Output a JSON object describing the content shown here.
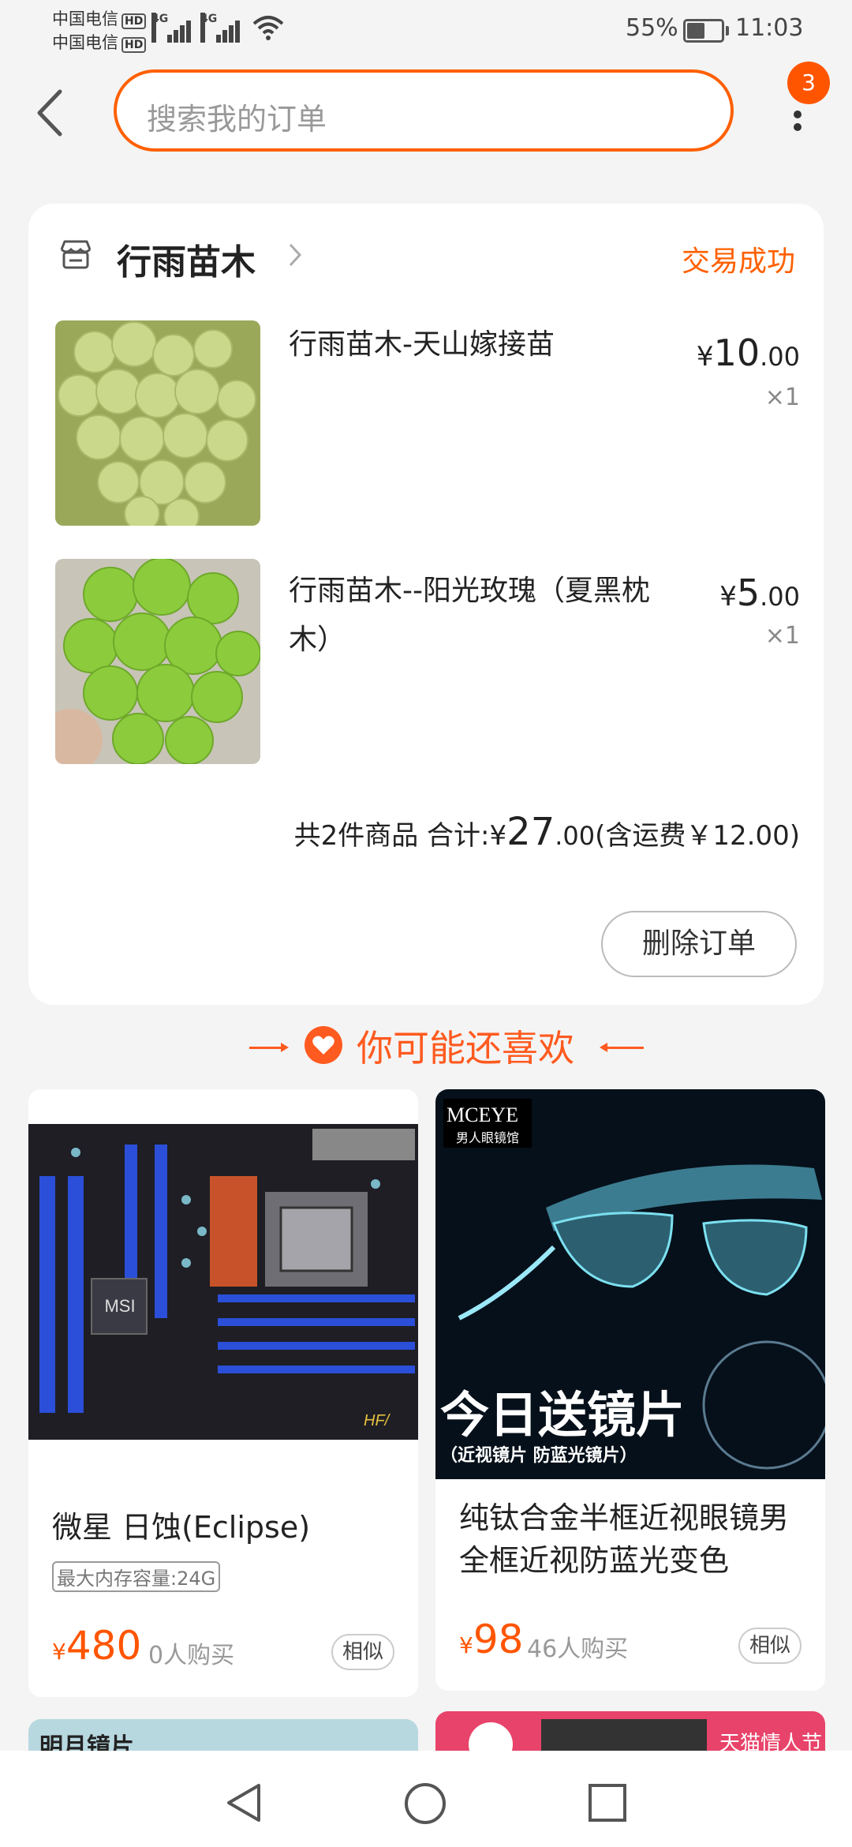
{
  "status_bar": {
    "carrier1": "中国电信",
    "carrier2": "中国电信",
    "hd": "HD",
    "network1": "4G",
    "network2": "4G",
    "battery": "55%",
    "time": "11:03"
  },
  "header": {
    "search_placeholder": "搜索我的订单",
    "more_badge": "3"
  },
  "order": {
    "shop_name": "行雨苗木",
    "status": "交易成功",
    "items": [
      {
        "title": "行雨苗木-天山嫁接苗",
        "currency": "¥",
        "price_int": "10",
        "price_dec": ".00",
        "qty": "×1",
        "image": "green grapes cluster"
      },
      {
        "title_line1": "行雨苗木--阳光玫瑰（夏黑枕",
        "title_line2": "木）",
        "currency": "¥",
        "price_int": "5",
        "price_dec": ".00",
        "qty": "×1",
        "image": "shine muscat grapes in hand"
      }
    ],
    "total_prefix": "共2件商品 合计:",
    "total_currency": "¥",
    "total_int": "27",
    "total_dec": ".00",
    "shipping": "(含运费￥12.00)",
    "delete_button": "删除订单"
  },
  "recommend": {
    "title": "你可能还喜欢",
    "products": [
      {
        "title": "微星 日蚀(Eclipse)",
        "tag": "最大内存容量:24G",
        "currency": "¥",
        "price": "480",
        "sold": "0人购买",
        "similar": "相似",
        "image": "MSI motherboard"
      },
      {
        "title_line1": "纯钛合金半框近视眼镜男",
        "title_line2": "全框近视防蓝光变色",
        "currency": "¥",
        "price": "98",
        "sold": "46人购买",
        "similar": "相似",
        "image": "glasses promo",
        "promo_brand": "MCEYE",
        "promo_brand_sub": "男人眼镜馆",
        "promo_headline": "今日送镜片",
        "promo_sub": "（近视镜片 防蓝光镜片）"
      }
    ],
    "next_row": {
      "left_label": "明月镜片",
      "right_label": "天猫情人节"
    }
  }
}
